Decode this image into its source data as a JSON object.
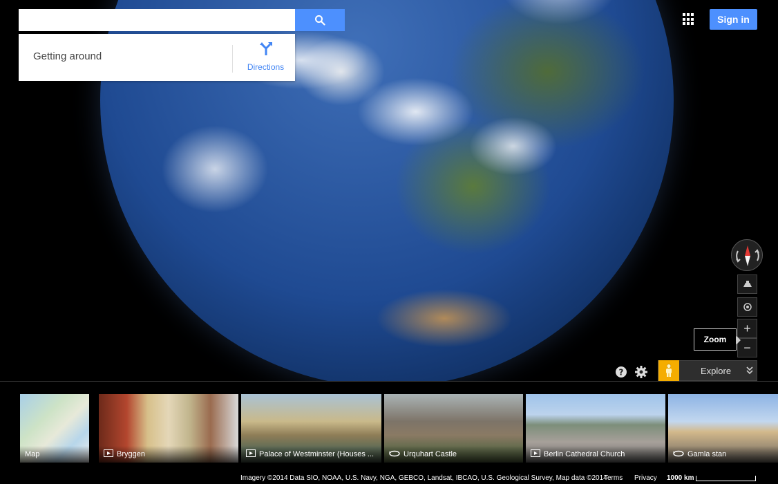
{
  "search": {
    "value": "",
    "placeholder": ""
  },
  "panel": {
    "title": "Getting around",
    "directions_label": "Directions"
  },
  "header": {
    "sign_in_label": "Sign in"
  },
  "controls": {
    "zoom_tooltip": "Zoom",
    "zoom_in": "+",
    "zoom_out": "−"
  },
  "explore": {
    "label": "Explore"
  },
  "thumbnails": [
    {
      "label": "Map",
      "type": "map"
    },
    {
      "label": "Bryggen",
      "type": "photo"
    },
    {
      "label": "Palace of Westminster (Houses ...",
      "type": "photo"
    },
    {
      "label": "Urquhart Castle",
      "type": "360"
    },
    {
      "label": "Berlin Cathedral Church",
      "type": "photo"
    },
    {
      "label": "Gamla stan",
      "type": "360"
    }
  ],
  "footer": {
    "attribution": "Imagery ©2014 Data SIO, NOAA, U.S. Navy, NGA, GEBCO, Landsat, IBCAO, U.S. Geological Survey, Map data ©2014",
    "terms": "Terms",
    "privacy": "Privacy",
    "scale": "1000 km"
  },
  "colors": {
    "accent": "#4d90fe",
    "pegman": "#f5ad00"
  }
}
